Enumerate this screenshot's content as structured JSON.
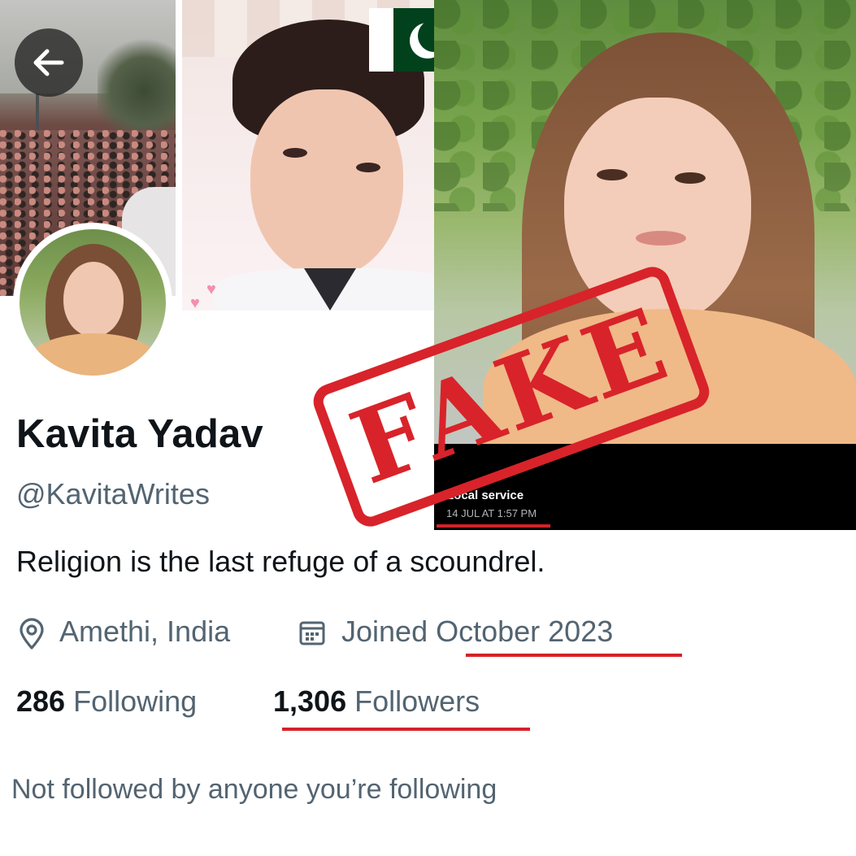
{
  "profile": {
    "display_name": "Kavita Yadav",
    "handle": "@KavitaWrites",
    "bio": "Religion is the last refuge of a scoundrel.",
    "location": "Amethi, India",
    "joined": "Joined October 2023",
    "following_count": "286",
    "following_label": "Following",
    "followers_count": "1,306",
    "followers_label": "Followers",
    "not_followed_text": "Not followed by anyone you’re following"
  },
  "caption": {
    "title": "Local service",
    "timestamp": "14 JUL AT 1:57 PM"
  },
  "stamp": {
    "text": "FAKE",
    "color": "#d8232a"
  },
  "icons": {
    "back": "arrow-left-icon",
    "location": "map-pin-icon",
    "calendar": "calendar-icon",
    "flag": "pakistan-flag"
  },
  "colors": {
    "text_primary": "#0f1419",
    "text_secondary": "#536471",
    "annotation_red": "#d52228"
  }
}
